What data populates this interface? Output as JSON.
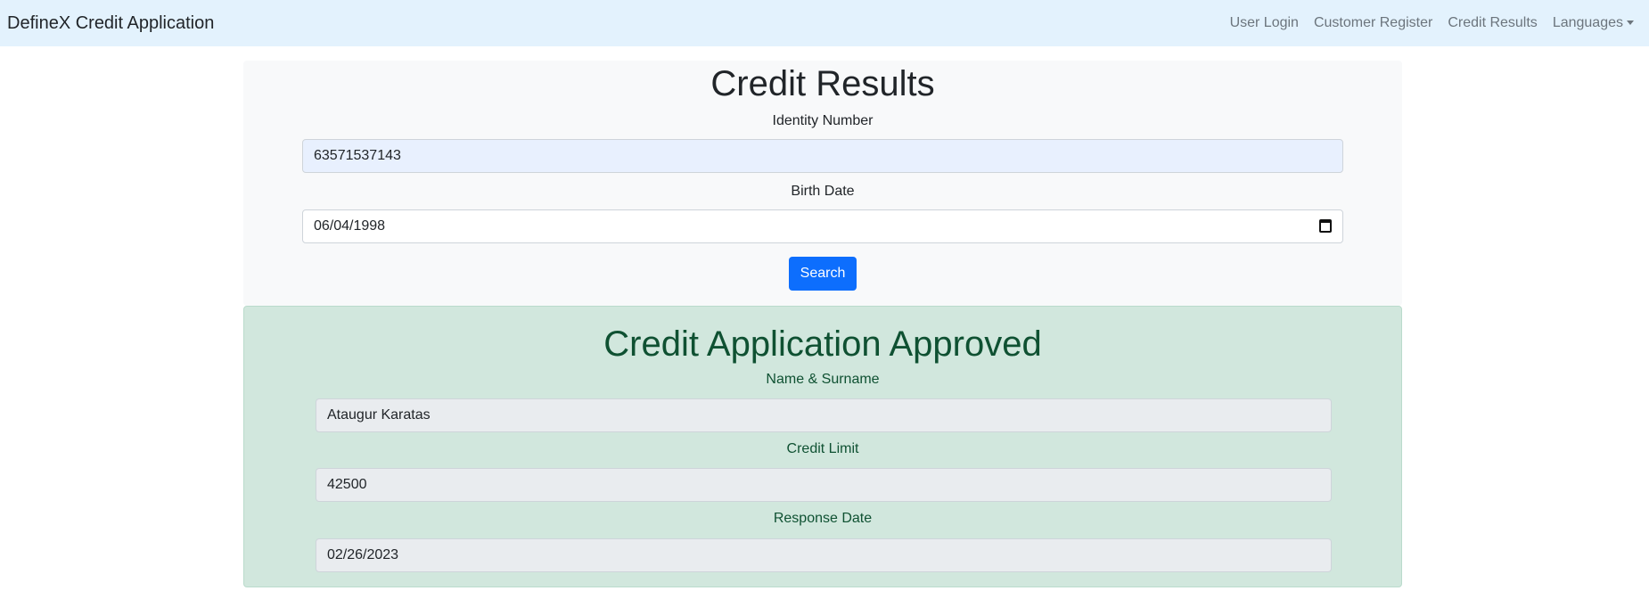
{
  "navbar": {
    "brand": "DefineX Credit Application",
    "links": [
      "User Login",
      "Customer Register",
      "Credit Results",
      "Languages"
    ]
  },
  "search": {
    "title": "Credit Results",
    "identity_label": "Identity Number",
    "identity_value": "63571537143",
    "birth_label": "Birth Date",
    "birth_value": "06/04/1998",
    "button": "Search"
  },
  "result": {
    "title": "Credit Application Approved",
    "name_label": "Name & Surname",
    "name_value": "Ataugur Karatas",
    "limit_label": "Credit Limit",
    "limit_value": "42500",
    "date_label": "Response Date",
    "date_value": "02/26/2023"
  },
  "colors": {
    "navbar_bg": "#e3f2fd",
    "primary": "#0d6efd",
    "success_bg": "#d1e7dd",
    "success_text": "#0f5132"
  },
  "icons": {
    "birth_date_picker": "calendar-icon",
    "languages_toggle": "caret-down-icon"
  }
}
